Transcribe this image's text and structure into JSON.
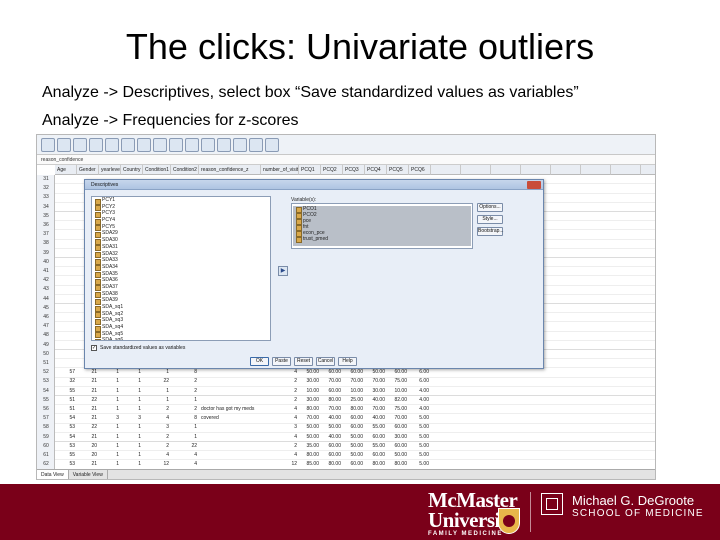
{
  "slide": {
    "title": "The clicks: Univariate outliers",
    "line1": "Analyze -> Descriptives, select box “Save standardized values as variables”",
    "line2": "Analyze -> Frequencies for z-scores"
  },
  "spss": {
    "varbar_text": "reason_confidence",
    "columns": [
      "Age",
      "Gender",
      "yearlevel",
      "Country",
      "Condition1",
      "Condition2",
      "reason_confidence_z",
      "number_of_visits",
      "PCQ1",
      "PCQ2",
      "PCQ3",
      "PCQ4",
      "PCQ5",
      "PCQ6"
    ],
    "row_numbers": [
      "31",
      "32",
      "33",
      "34",
      "35",
      "36",
      "37",
      "38",
      "39",
      "40",
      "41",
      "42",
      "43",
      "44",
      "45",
      "46",
      "47",
      "48",
      "49",
      "50",
      "51",
      "52",
      "53",
      "54",
      "55",
      "56",
      "57",
      "58",
      "59",
      "60",
      "61",
      "62"
    ],
    "rows": [
      [
        "57",
        "21",
        "1",
        "1",
        "1",
        "8",
        "",
        "4",
        "50.00",
        "60.00",
        "60.00",
        "50.00",
        "60.00",
        "6.00"
      ],
      [
        "32",
        "21",
        "1",
        "1",
        "22",
        "2",
        "",
        "2",
        "30.00",
        "70.00",
        "70.00",
        "70.00",
        "75.00",
        "6.00"
      ],
      [
        "55",
        "21",
        "1",
        "1",
        "1",
        "2",
        "",
        "2",
        "10.00",
        "60.00",
        "10.00",
        "30.00",
        "10.00",
        "4.00"
      ],
      [
        "51",
        "22",
        "1",
        "1",
        "1",
        "1",
        "",
        "2",
        "30.00",
        "80.00",
        "25.00",
        "40.00",
        "82.00",
        "4.00"
      ],
      [
        "51",
        "21",
        "1",
        "1",
        "2",
        "2",
        "doctor has got my meds covered",
        "4",
        "80.00",
        "70.00",
        "80.00",
        "70.00",
        "75.00",
        "4.00"
      ],
      [
        "54",
        "21",
        "3",
        "3",
        "4",
        "8",
        "",
        "4",
        "70.00",
        "40.00",
        "60.00",
        "40.00",
        "70.00",
        "5.00"
      ],
      [
        "53",
        "22",
        "1",
        "1",
        "3",
        "1",
        "",
        "3",
        "50.00",
        "50.00",
        "60.00",
        "55.00",
        "60.00",
        "5.00"
      ],
      [
        "54",
        "21",
        "1",
        "1",
        "2",
        "1",
        "",
        "4",
        "50.00",
        "40.00",
        "50.00",
        "60.00",
        "30.00",
        "5.00"
      ],
      [
        "53",
        "20",
        "1",
        "1",
        "2",
        "22",
        "",
        "2",
        "35.00",
        "60.00",
        "50.00",
        "55.00",
        "60.00",
        "5.00"
      ],
      [
        "55",
        "20",
        "1",
        "1",
        "4",
        "4",
        "",
        "4",
        "80.00",
        "60.00",
        "50.00",
        "60.00",
        "50.00",
        "5.00"
      ],
      [
        "53",
        "21",
        "1",
        "1",
        "12",
        "4",
        "",
        "12",
        "85.00",
        "80.00",
        "60.00",
        "80.00",
        "80.00",
        "5.00"
      ]
    ],
    "tabs": [
      "Data View",
      "Variable View"
    ],
    "dialog": {
      "title": "Descriptives",
      "source_vars": [
        "PCY1",
        "PCY2",
        "PCY3",
        "PCY4",
        "PCY5",
        "SDA29",
        "SDA30",
        "SDA31",
        "SDA32",
        "SDA33",
        "SDA34",
        "SDA35",
        "SDA36",
        "SDA37",
        "SDA38",
        "SDA39",
        "SDA_sq1",
        "SDA_sq2",
        "SDA_sq3",
        "SDA_sq4",
        "SDA_sq5",
        "SDA_sq6"
      ],
      "variables_label": "Variable(s):",
      "target_vars": [
        "PCO1",
        "PCO2",
        "pce",
        "fnt",
        "econ_pce",
        "trust_pmed"
      ],
      "side_buttons": [
        "Options...",
        "Style...",
        "Bootstrap..."
      ],
      "checkbox_label": "Save standardized values as variables",
      "buttons": [
        "OK",
        "Paste",
        "Reset",
        "Cancel",
        "Help"
      ]
    }
  },
  "footer": {
    "mcmaster_name1": "McMaster",
    "mcmaster_name2": "University",
    "mcmaster_sub": "FAMILY MEDICINE",
    "degroote_line1": "Michael G. DeGroote",
    "degroote_line2": "SCHOOL OF MEDICINE"
  }
}
